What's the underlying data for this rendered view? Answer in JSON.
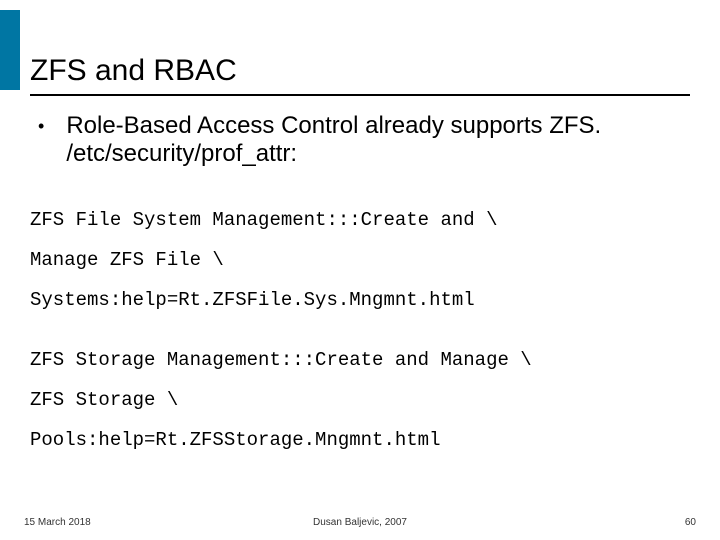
{
  "slide": {
    "title": "ZFS and RBAC",
    "bullet_symbol": "•",
    "bullet_text": "Role-Based Access Control already supports ZFS. /etc/security/prof_attr:",
    "code_block_1": {
      "line1": "ZFS File System Management:::Create and \\",
      "line2": "Manage ZFS File \\",
      "line3": "Systems:help=Rt.ZFSFile.Sys.Mngmnt.html"
    },
    "code_block_2": {
      "line1": "ZFS Storage Management:::Create and Manage \\",
      "line2": "ZFS Storage \\",
      "line3": "Pools:help=Rt.ZFSStorage.Mngmnt.html"
    }
  },
  "footer": {
    "date": "15 March 2018",
    "author": "Dusan Baljevic, 2007",
    "page": "60"
  }
}
